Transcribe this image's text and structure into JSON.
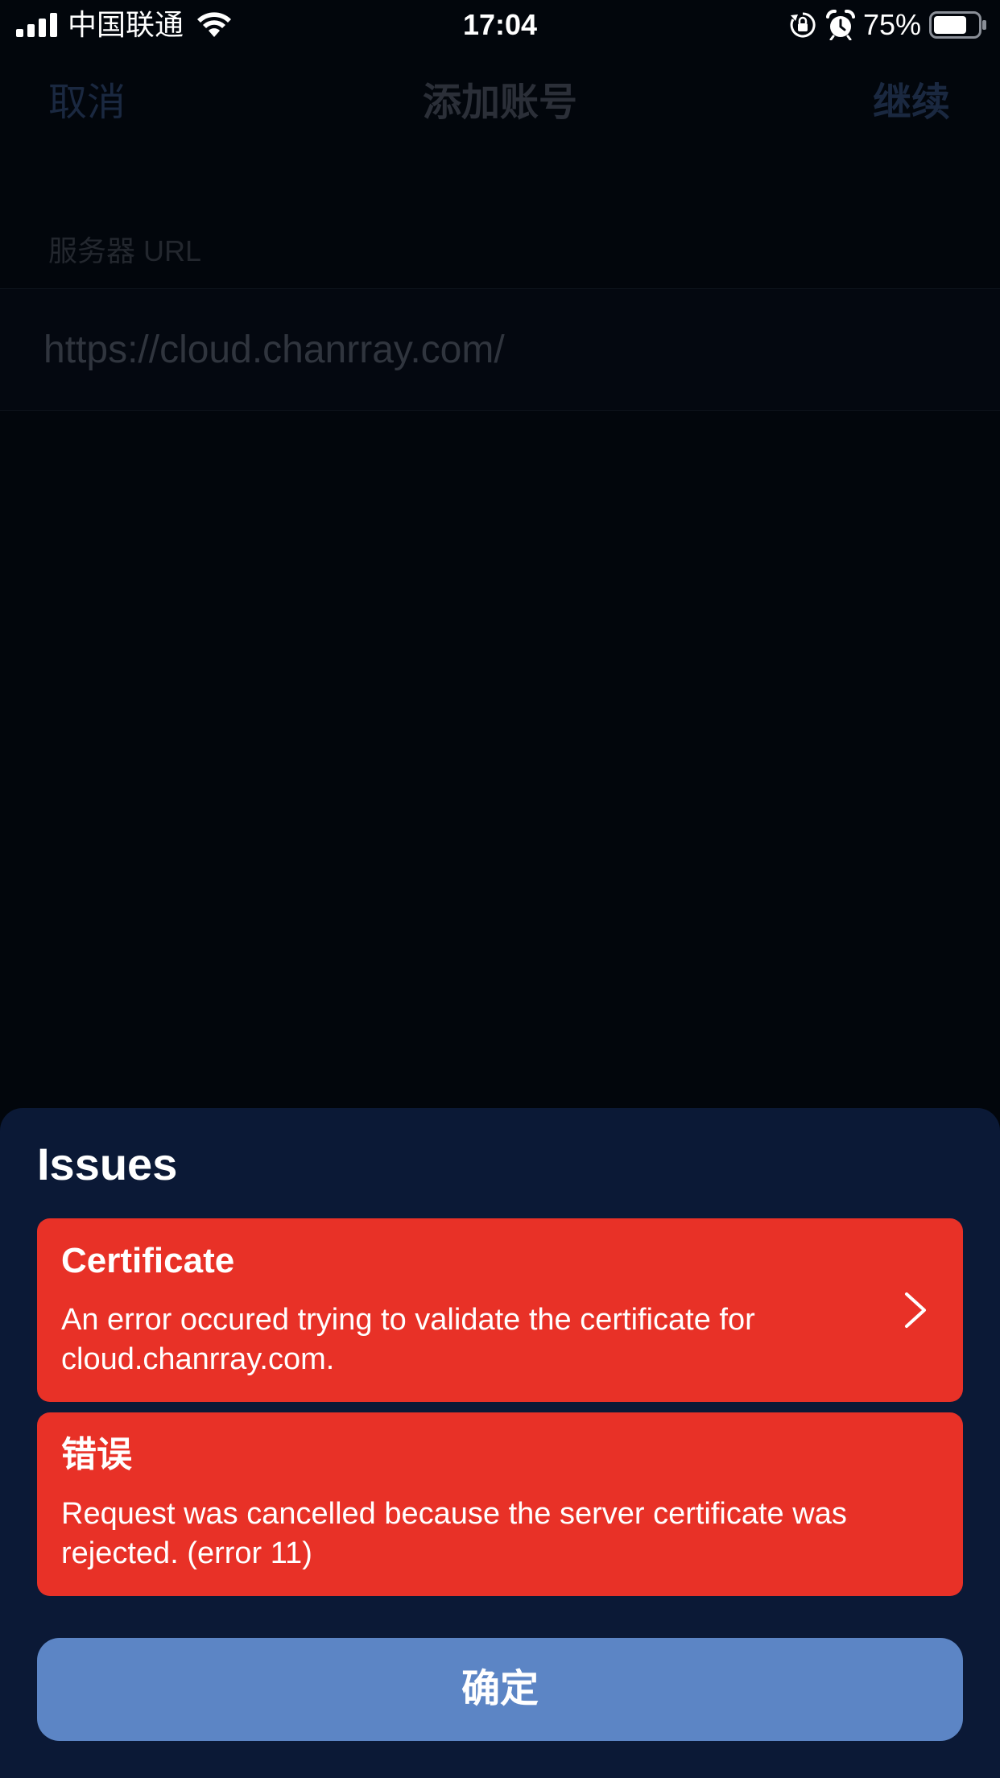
{
  "status_bar": {
    "carrier": "中国联通",
    "time": "17:04",
    "battery_percent": "75%",
    "battery_level": 0.75,
    "icons": [
      "signal-icon",
      "wifi-icon",
      "rotation-lock-icon",
      "alarm-icon",
      "battery-icon"
    ]
  },
  "nav": {
    "cancel_label": "取消",
    "title": "添加账号",
    "continue_label": "继续"
  },
  "form": {
    "server_url_label": "服务器 URL",
    "server_url_value": "https://cloud.chanrray.com/"
  },
  "sheet": {
    "title": "Issues",
    "issues": [
      {
        "title": "Certificate",
        "message": "An error occured trying to validate the certificate for cloud.chanrray.com.",
        "has_chevron": true
      },
      {
        "title": "错误",
        "message": "Request was cancelled because the server certificate was rejected. (error 11)",
        "has_chevron": false
      }
    ],
    "confirm_label": "确定"
  },
  "colors": {
    "background": "#02060c",
    "sheet": "#0b1936",
    "issue_card": "#e83127",
    "confirm_button": "#5c85c5",
    "text_primary": "#ffffff"
  }
}
